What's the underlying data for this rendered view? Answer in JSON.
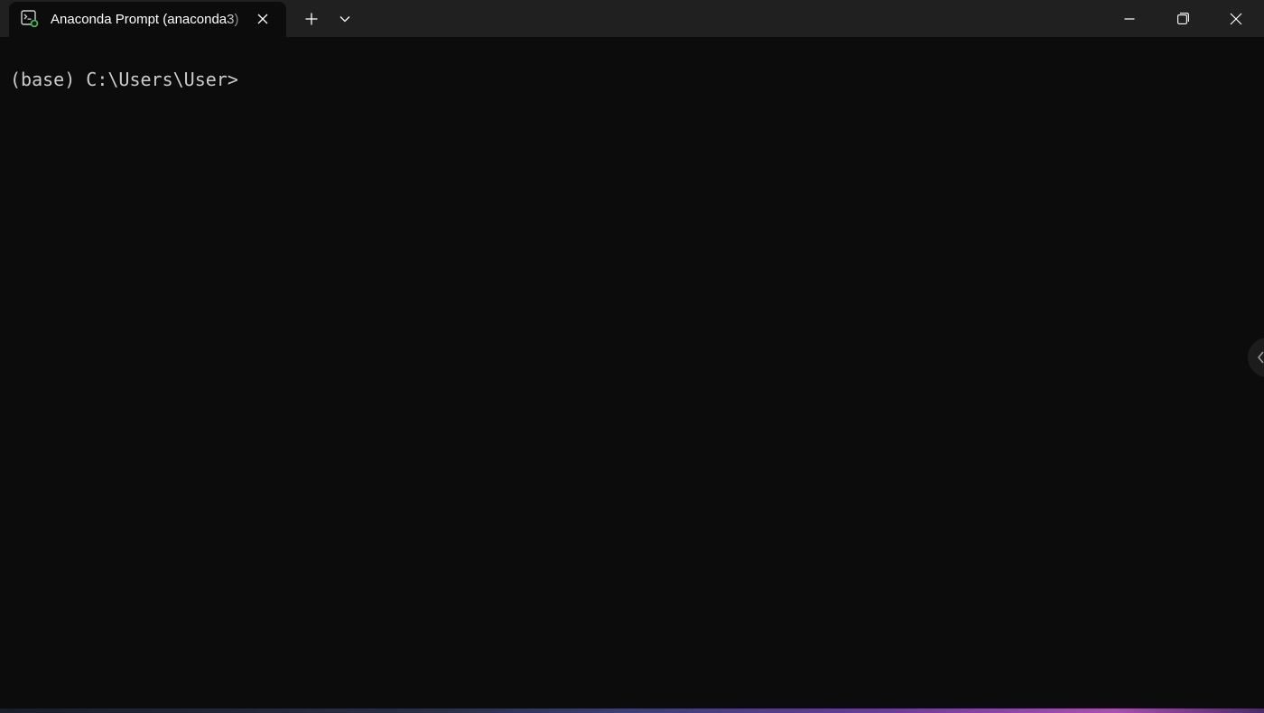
{
  "tab": {
    "title": "Anaconda Prompt (anaconda3)",
    "icon": "terminal-icon"
  },
  "titlebar": {
    "new_tab_icon": "plus-icon",
    "dropdown_icon": "chevron-down-icon",
    "minimize_icon": "minimize-icon",
    "maximize_icon": "restore-icon",
    "close_icon": "close-icon"
  },
  "terminal": {
    "prompt": "(base) C:\\Users\\User>"
  },
  "colors": {
    "titlebar_bg": "#202020",
    "terminal_bg": "#0c0c0c",
    "terminal_text": "#cccccc",
    "icon_accent": "#3fb950"
  }
}
